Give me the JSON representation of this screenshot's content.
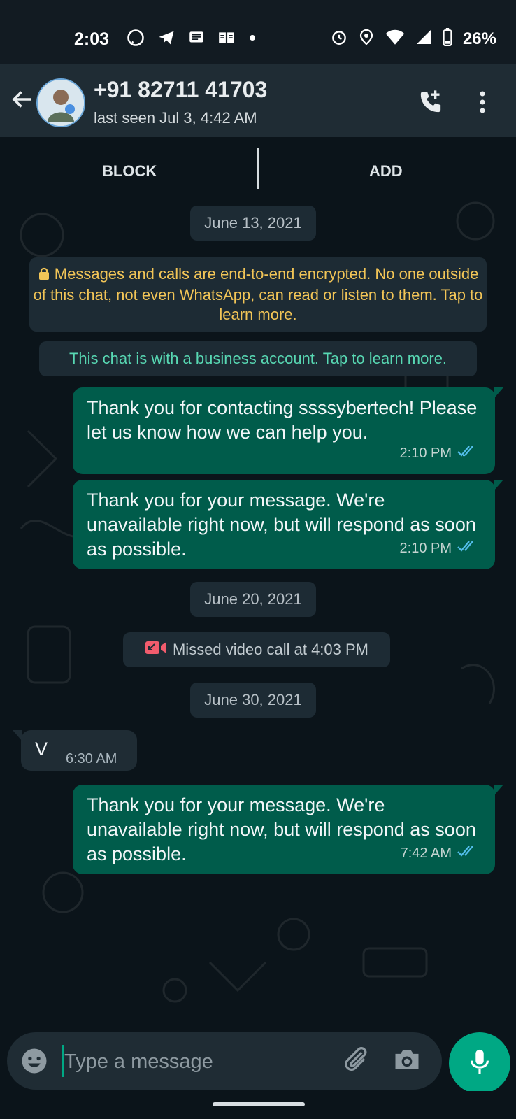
{
  "status": {
    "time": "2:03",
    "battery": "26%"
  },
  "header": {
    "contact": "+91 82711 41703",
    "last_seen": "last seen Jul 3, 4:42 AM"
  },
  "actions": {
    "block": "BLOCK",
    "add": "ADD"
  },
  "dates": {
    "d1": "June 13, 2021",
    "d2": "June 20, 2021",
    "d3": "June 30, 2021"
  },
  "system": {
    "encryption_notice": "Messages and calls are end-to-end encrypted. No one outside of this chat, not even WhatsApp, can read or listen to them. Tap to learn more.",
    "business_notice": "This chat is with a business account. Tap to learn more.",
    "missed_call": "Missed video call at 4:03 PM"
  },
  "messages": [
    {
      "dir": "out",
      "text": "Thank you for contacting ssssybertech! Please let us know how we can help you.",
      "time": "2:10 PM"
    },
    {
      "dir": "out",
      "text": "Thank you for your message. We're unavailable right now, but will respond as soon as possible.",
      "time": "2:10 PM"
    },
    {
      "dir": "in",
      "text": "V",
      "time": "6:30 AM"
    },
    {
      "dir": "out",
      "text": "Thank you for your message. We're unavailable right now, but will respond as soon as possible.",
      "time": "7:42 AM"
    }
  ],
  "composer": {
    "placeholder": "Type a message"
  },
  "colors": {
    "accent": "#00a884",
    "outgoing": "#005c4b",
    "incoming": "#1f2c34"
  }
}
